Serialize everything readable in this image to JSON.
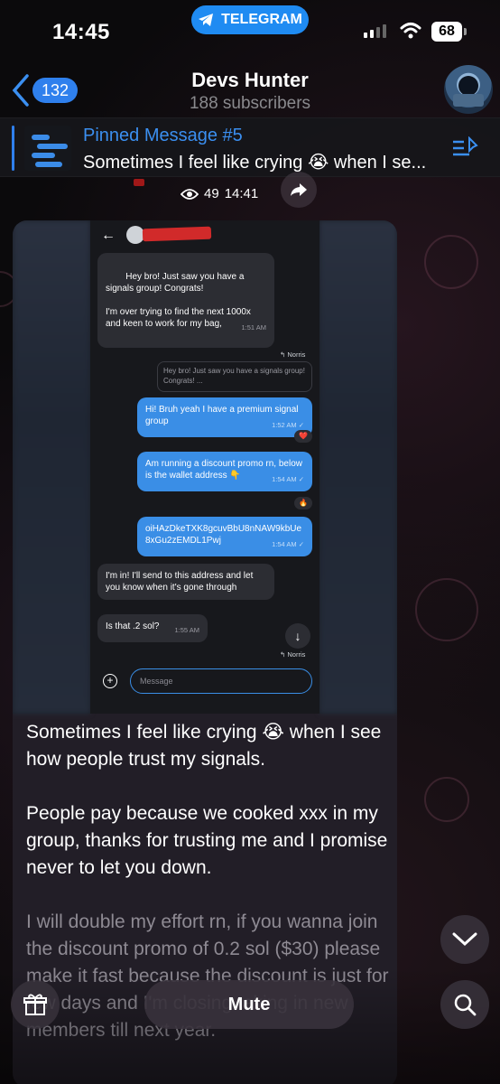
{
  "status_bar": {
    "time": "14:45",
    "app_pill": "TELEGRAM",
    "battery": "68"
  },
  "header": {
    "back_count": "132",
    "title": "Devs Hunter",
    "subtitle": "188 subscribers"
  },
  "pinned": {
    "title": "Pinned Message #5",
    "text": "Sometimes I feel like crying 😭 when I se..."
  },
  "post_meta": {
    "views": "49",
    "time": "14:41"
  },
  "screenshot": {
    "back_glyph": "←",
    "messages": [
      {
        "dir": "in",
        "text": "Hey bro! Just saw you have a signals group! Congrats!\n\nI'm over trying to find the next 1000x and keen to work for my bag,",
        "time": "1:51 AM"
      },
      {
        "dir": "reply",
        "text": "↰ Norris"
      },
      {
        "dir": "quote",
        "text": "Hey bro! Just saw you have a signals group! Congrats! ..."
      },
      {
        "dir": "out",
        "text": "Hi! Bruh yeah I have a premium signal group",
        "time": "1:52 AM ✓",
        "reaction": "❤️"
      },
      {
        "dir": "out",
        "text": "Am running a discount promo rn, below is the wallet address 👇",
        "time": "1:54 AM ✓",
        "reaction": "🔥"
      },
      {
        "dir": "out",
        "text": "oiHAzDkeTXK8gcuvBbU8nNAW9kbUe8xGu2zEMDL1Pwj",
        "time": "1:54 AM ✓"
      },
      {
        "dir": "in",
        "text": "I'm in! I'll send to this address and let you know when it's gone through"
      },
      {
        "dir": "in",
        "text": "Is that .2 sol?",
        "time": "1:55 AM"
      },
      {
        "dir": "reply",
        "text": "↰ Norris"
      }
    ],
    "input_placeholder": "Message"
  },
  "post_text": [
    "Sometimes I feel like crying 😭 when I see how people trust my signals.",
    "People pay because we cooked xxx in my group, thanks for trusting me and I promise never to let you down.",
    "I will double my effort rn, if you wanna join the discount promo of 0.2 sol ($30) please make it fast because the discount is just for few days and I'm closing taking in new members till next year."
  ],
  "bottom_bar": {
    "mute_label": "Mute"
  },
  "colors": {
    "accent": "#2f80ed",
    "telegram_pill": "#1f8bf2",
    "bubble_out": "#3a8ee6",
    "card": "#221e27"
  }
}
